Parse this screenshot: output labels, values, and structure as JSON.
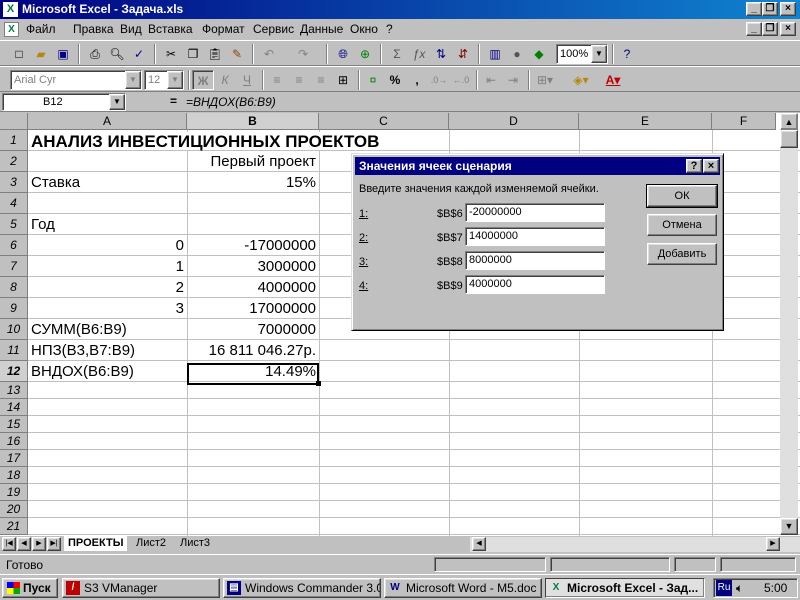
{
  "window": {
    "title": "Microsoft Excel - Задача.xls"
  },
  "menu": [
    "Файл",
    "Правка",
    "Вид",
    "Вставка",
    "Формат",
    "Сервис",
    "Данные",
    "Окно",
    "?"
  ],
  "toolbar": {
    "zoom": "100%"
  },
  "format_toolbar": {
    "font": "Arial Cyr",
    "size": "12",
    "bold": "Ж",
    "italic": "К",
    "underline": "Ч",
    "percent": "%",
    "comma": ","
  },
  "formula_bar": {
    "cell_ref": "B12",
    "eq": "=",
    "formula": "=ВНДОХ(B6:B9)"
  },
  "columns": [
    "A",
    "B",
    "C",
    "D",
    "E",
    "F"
  ],
  "rows": [
    "1",
    "2",
    "3",
    "4",
    "5",
    "6",
    "7",
    "8",
    "9",
    "10",
    "11",
    "12",
    "13",
    "14",
    "15",
    "16",
    "17",
    "18",
    "19",
    "20",
    "21"
  ],
  "cells": {
    "A1": "АНАЛИЗ  ИНВЕСТИЦИОННЫХ  ПРОЕКТОВ",
    "B2": "Первый проект",
    "A3": "Ставка",
    "B3": "15%",
    "A5": "Год",
    "A6": "0",
    "B6": "-17000000",
    "A7": "1",
    "B7": "3000000",
    "A8": "2",
    "B8": "4000000",
    "A9": "3",
    "B9": "17000000",
    "A10": "СУММ(B6:B9)",
    "B10": "7000000",
    "A11": "НПЗ(B3,B7:B9)",
    "B11": "16 811 046.27р.",
    "A12": "ВНДОХ(B6:B9)",
    "B12": "14.49%"
  },
  "sheet_tabs": [
    "ПРОЕКТЫ",
    "Лист2",
    "Лист3"
  ],
  "status": "Готово",
  "taskbar": {
    "start": "Пуск",
    "tasks": [
      "S3 VManager",
      "Windows Commander 3.0...",
      "Microsoft Word - M5.doc",
      "Microsoft Excel - Зад..."
    ],
    "lang": "Ru",
    "time": "5:00"
  },
  "dialog": {
    "title": "Значения ячеек сценария",
    "help": "?",
    "close": "×",
    "prompt": "Введите значения каждой изменяемой ячейки.",
    "fields": [
      {
        "num": "1:",
        "ref": "$B$6",
        "value": "-20000000"
      },
      {
        "num": "2:",
        "ref": "$B$7",
        "value": "14000000"
      },
      {
        "num": "3:",
        "ref": "$B$8",
        "value": "8000000"
      },
      {
        "num": "4:",
        "ref": "$B$9",
        "value": "4000000"
      }
    ],
    "ok": "ОК",
    "cancel": "Отмена",
    "add": "Добавить"
  }
}
